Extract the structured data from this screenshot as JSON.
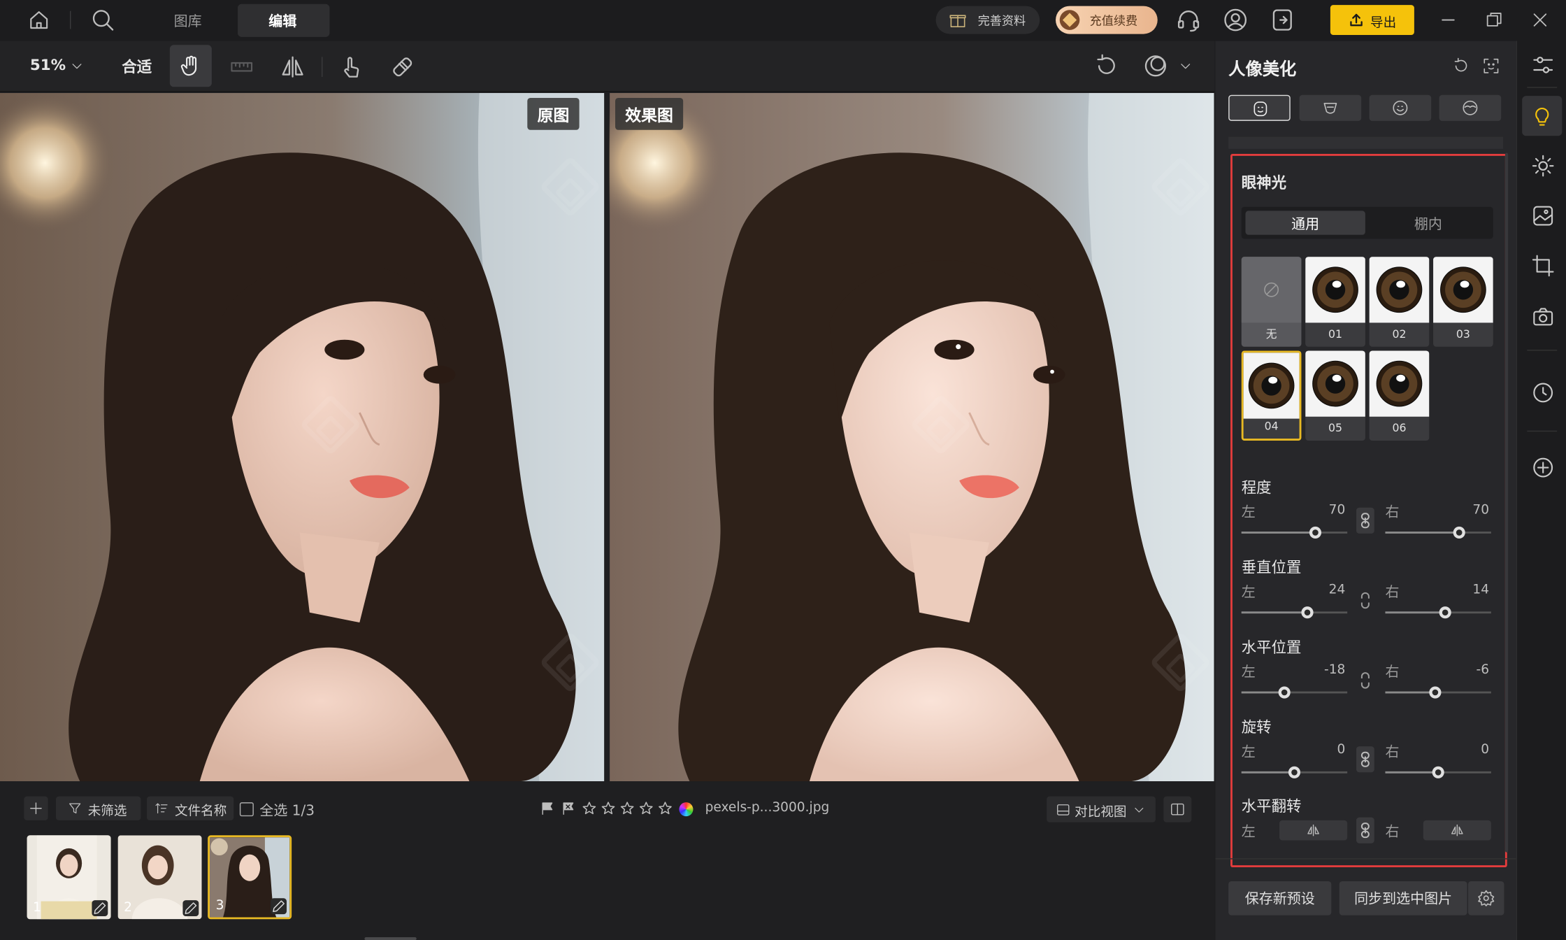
{
  "topbar": {
    "tabs": [
      "图库",
      "编辑"
    ],
    "active_tab": "编辑",
    "complete_profile": "完善资料",
    "recharge": "充值续费",
    "export": "导出"
  },
  "toolbar": {
    "zoom": "51%",
    "fit": "合适"
  },
  "compare": {
    "original_tag": "原图",
    "result_tag": "效果图"
  },
  "filmstrip": {
    "filter": "未筛选",
    "sort": "文件名称",
    "select_all": "全选 1/3",
    "filename": "pexels-p...3000.jpg",
    "view_mode": "对比视图",
    "rating": 0,
    "thumbnails": [
      {
        "num": "1"
      },
      {
        "num": "2"
      },
      {
        "num": "3",
        "selected": true
      }
    ]
  },
  "panel": {
    "title": "人像美化",
    "section_title": "眼神光",
    "mode_tabs": [
      "通用",
      "棚内"
    ],
    "active_mode": "通用",
    "presets": [
      {
        "label": "无",
        "none": true
      },
      {
        "label": "01"
      },
      {
        "label": "02"
      },
      {
        "label": "03"
      },
      {
        "label": "04",
        "selected": true
      },
      {
        "label": "05"
      },
      {
        "label": "06"
      }
    ],
    "sliders": [
      {
        "name": "程度",
        "left_label": "左",
        "right_label": "右",
        "left": "70",
        "right": "70",
        "left_frac": 0.7,
        "right_frac": 0.7
      },
      {
        "name": "垂直位置",
        "left_label": "左",
        "right_label": "右",
        "left": "24",
        "right": "14",
        "left_frac": 0.62,
        "right_frac": 0.57
      },
      {
        "name": "水平位置",
        "left_label": "左",
        "right_label": "右",
        "left": "-18",
        "right": "-6",
        "left_frac": 0.41,
        "right_frac": 0.47
      },
      {
        "name": "旋转",
        "left_label": "左",
        "right_label": "右",
        "left": "0",
        "right": "0",
        "left_frac": 0.5,
        "right_frac": 0.5
      }
    ],
    "flip": {
      "name": "水平翻转",
      "left_label": "左",
      "right_label": "右"
    },
    "save_preset": "保存新预设",
    "sync": "同步到选中图片"
  },
  "colors": {
    "accent_yellow": "#f5c20b",
    "highlight_red": "#e23c3c",
    "selection_yellow": "#e8b923"
  }
}
